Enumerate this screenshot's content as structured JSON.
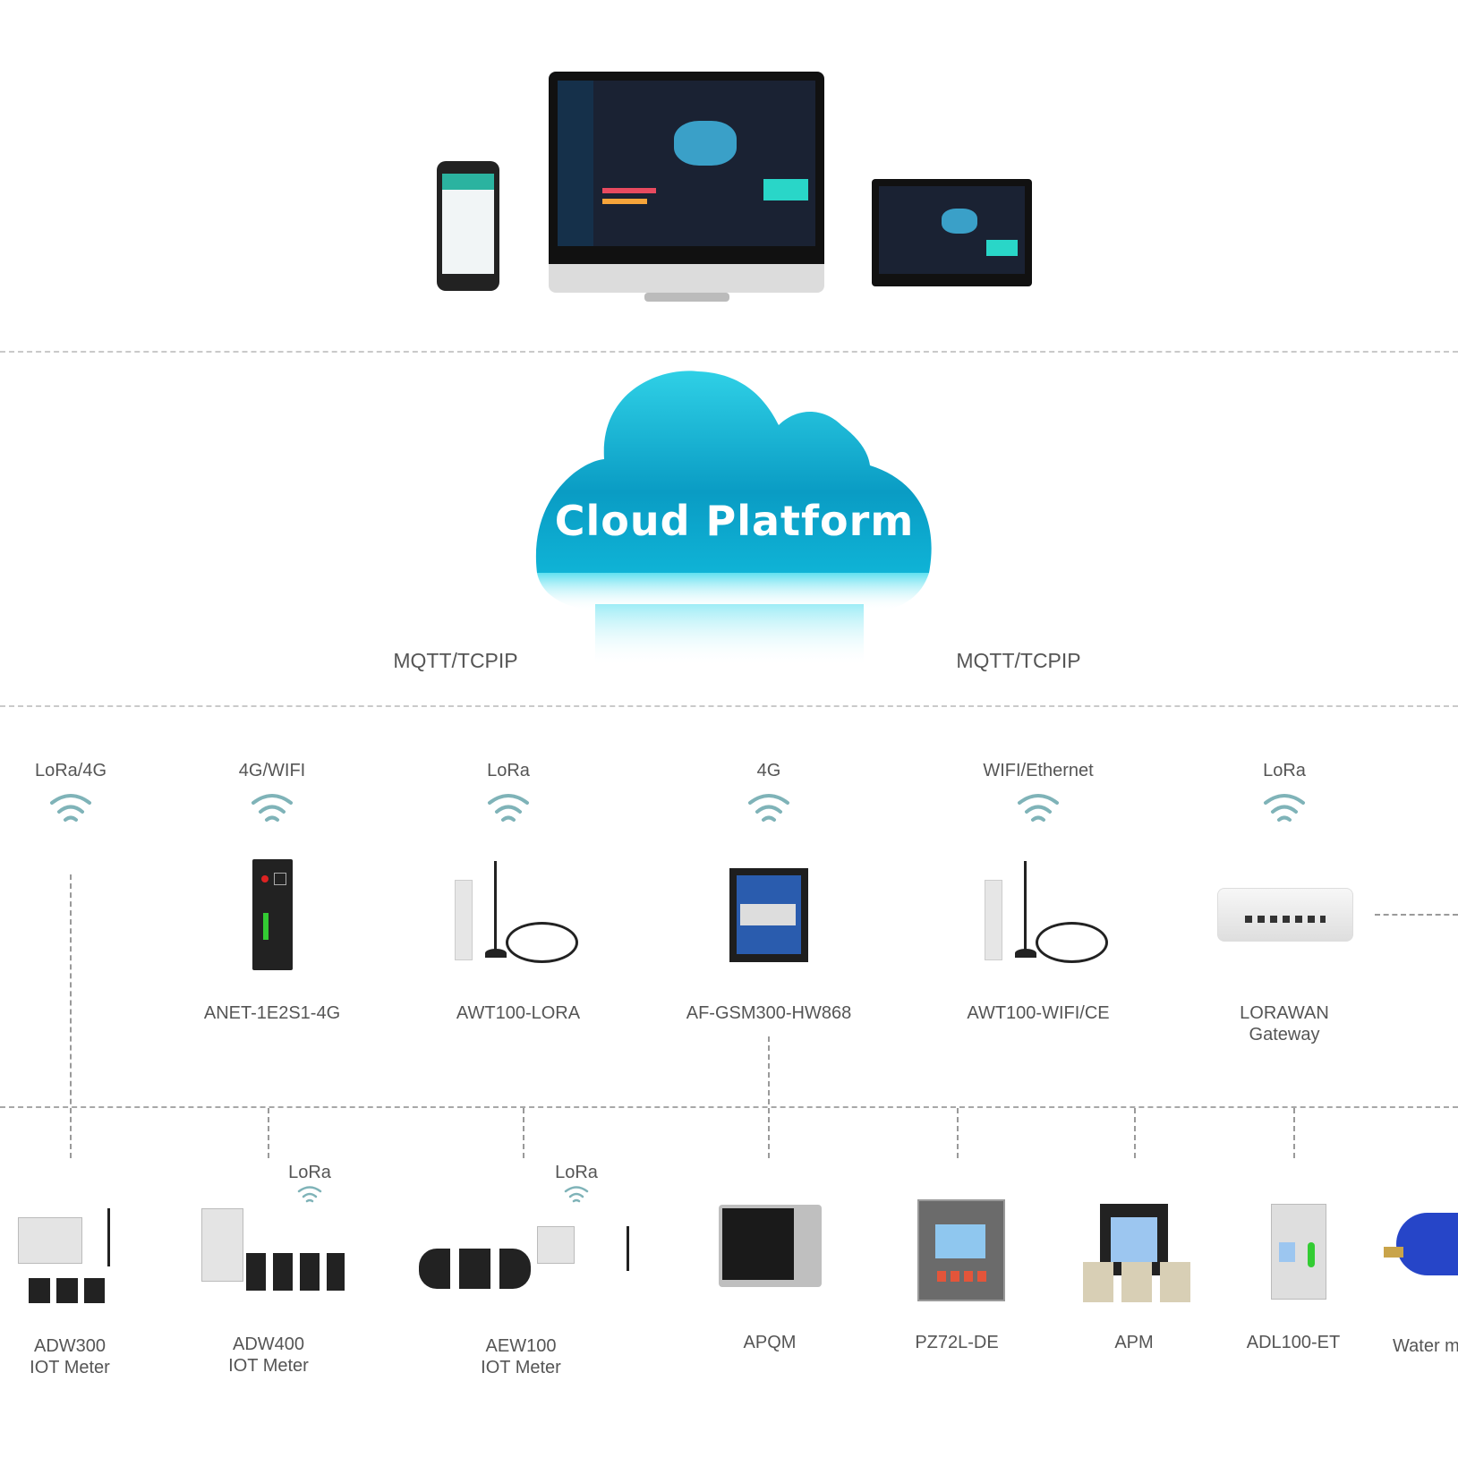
{
  "top": {
    "devices": [
      "phone",
      "desktop-monitor",
      "tablet"
    ]
  },
  "cloud": {
    "title": "Cloud Platform",
    "color_top": "#0aa5c9",
    "color_bottom": "#b8f3fb"
  },
  "protocols": {
    "left": "MQTT/TCPIP",
    "right": "MQTT/TCPIP"
  },
  "gateways": [
    {
      "protocol": "LoRa/4G",
      "name": ""
    },
    {
      "protocol": "4G/WIFI",
      "name": "ANET-1E2S1-4G"
    },
    {
      "protocol": "LoRa",
      "name": "AWT100-LORA"
    },
    {
      "protocol": "4G",
      "name": "AF-GSM300-HW868"
    },
    {
      "protocol": "WIFI/Ethernet",
      "name": "AWT100-WIFI/CE"
    },
    {
      "protocol": "LoRa",
      "name": "LORAWAN",
      "name2": "Gateway"
    }
  ],
  "meters": [
    {
      "name": "ADW300",
      "name2": "IOT  Meter"
    },
    {
      "name": "ADW400",
      "name2": "IOT  Meter",
      "protocol": "LoRa"
    },
    {
      "name": "AEW100",
      "name2": "IOT  Meter",
      "protocol": "LoRa"
    },
    {
      "name": "APQM"
    },
    {
      "name": "PZ72L-DE"
    },
    {
      "name": "APM"
    },
    {
      "name": "ADL100-ET"
    },
    {
      "name": "Water m"
    }
  ],
  "colors": {
    "wifi": "#7fb3b8",
    "dash": "#c9c9c9",
    "text": "#555555"
  }
}
